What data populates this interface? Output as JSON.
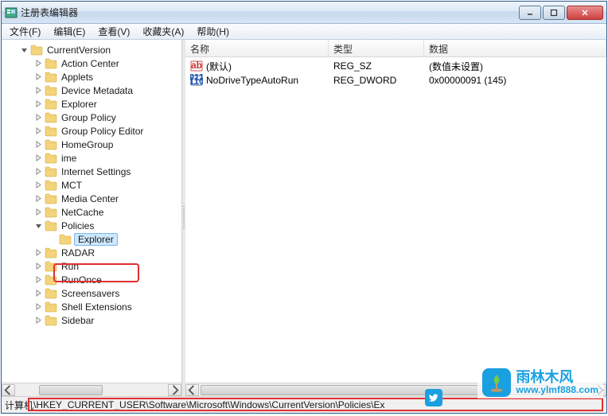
{
  "window": {
    "title": "注册表编辑器"
  },
  "menu": {
    "file": "文件(F)",
    "edit": "编辑(E)",
    "view": "查看(V)",
    "favorites": "收藏夹(A)",
    "help": "帮助(H)"
  },
  "tree": {
    "root": "CurrentVersion",
    "children": [
      "Action Center",
      "Applets",
      "Device Metadata",
      "Explorer",
      "Group Policy",
      "Group Policy Editor",
      "HomeGroup",
      "ime",
      "Internet Settings",
      "MCT",
      "Media Center",
      "NetCache",
      "Policies",
      "RADAR",
      "Run",
      "RunOnce",
      "Screensavers",
      "Shell Extensions",
      "Sidebar"
    ],
    "policies_child": "Explorer",
    "selected": "Explorer"
  },
  "list": {
    "columns": {
      "name": "名称",
      "type": "类型",
      "data": "数据"
    },
    "rows": [
      {
        "icon": "string",
        "name": "(默认)",
        "type": "REG_SZ",
        "data": "(数值未设置)"
      },
      {
        "icon": "binary",
        "name": "NoDriveTypeAutoRun",
        "type": "REG_DWORD",
        "data": "0x00000091 (145)"
      }
    ]
  },
  "status": {
    "prefix": "计算机",
    "path": "\\HKEY_CURRENT_USER\\Software\\Microsoft\\Windows\\CurrentVersion\\Policies\\Ex"
  },
  "watermark": {
    "cn": "雨林木风",
    "url": "www.ylmf888.com"
  }
}
